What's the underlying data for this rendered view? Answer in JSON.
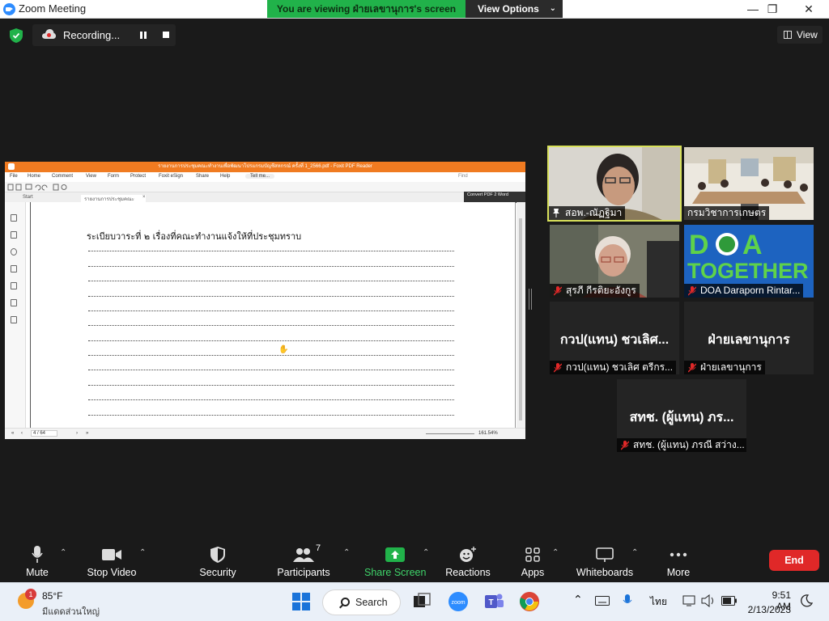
{
  "window": {
    "title": "Zoom Meeting",
    "minimize": "—",
    "maximize": "❐",
    "close": "✕"
  },
  "banner": {
    "prefix": "You are viewing ",
    "presenter": "ฝ่ายเลขานุการ",
    "suffix": "'s screen",
    "view_options": "View Options"
  },
  "recording": {
    "label": "Recording..."
  },
  "view_button": {
    "label": "View"
  },
  "shared_screen": {
    "app_title": "รายงานการประชุมคณะทำงานเพื่อพัฒนาโปรแกรมบัญชีสหกรณ์ ครั้งที่ 1_2566.pdf - Foxit PDF Reader",
    "menu": [
      "File",
      "Home",
      "Comment",
      "View",
      "Form",
      "Protect",
      "Foxit eSign",
      "Share",
      "Help",
      "Tell me..."
    ],
    "find_placeholder": "Find",
    "tabs": [
      "Start",
      "รายงานการประชุมคณะทำงาน..."
    ],
    "convert": "Convert PDF 2 Word",
    "heading": "ระเบียบวาระที่ ๒ เรื่องที่คณะทำงานแจ้งให้ที่ประชุมทราบ",
    "page_indicator": "4 / 64",
    "zoom": "161.54%"
  },
  "participants": [
    {
      "name": "สอพ.-ณัฏฐิมา",
      "pinned": true,
      "muted": false
    },
    {
      "name": "กรมวิชาการเกษตร",
      "pinned": false,
      "muted": false
    },
    {
      "name": "สุรภี กีรติยะอังกูร",
      "pinned": false,
      "muted": true
    },
    {
      "name": "DOA Daraporn Rintar...",
      "pinned": false,
      "muted": true,
      "tile_text": "DOA TOGETHER"
    },
    {
      "name": "กวป(แทน) ชวเลิศ ตรีกร...",
      "pinned": false,
      "muted": true,
      "display": "กวป(แทน) ชวเลิศ..."
    },
    {
      "name": "ฝ่ายเลขานุการ",
      "pinned": false,
      "muted": true,
      "display": "ฝ่ายเลขานุการ"
    },
    {
      "name": "สทช. (ผู้แทน) ภรณี สว่าง...",
      "pinned": false,
      "muted": true,
      "display": "สทช. (ผู้แทน) ภร..."
    }
  ],
  "toolbar": {
    "mute": "Mute",
    "stop_video": "Stop Video",
    "security": "Security",
    "participants": "Participants",
    "participants_count": "7",
    "share_screen": "Share Screen",
    "reactions": "Reactions",
    "apps": "Apps",
    "whiteboards": "Whiteboards",
    "more": "More",
    "end": "End"
  },
  "taskbar": {
    "weather_badge": "1",
    "weather_temp": "85°F",
    "weather_desc": "มีแดดส่วนใหญ่",
    "search": "Search",
    "language": "ไทย",
    "time": "9:51 AM",
    "date": "2/13/2023"
  },
  "colors": {
    "banner_green": "#21b24a",
    "share_green": "#21b24a",
    "end_red": "#e02828",
    "foxit_orange": "#f07b21",
    "active_speaker_border": "#d7e05a"
  }
}
